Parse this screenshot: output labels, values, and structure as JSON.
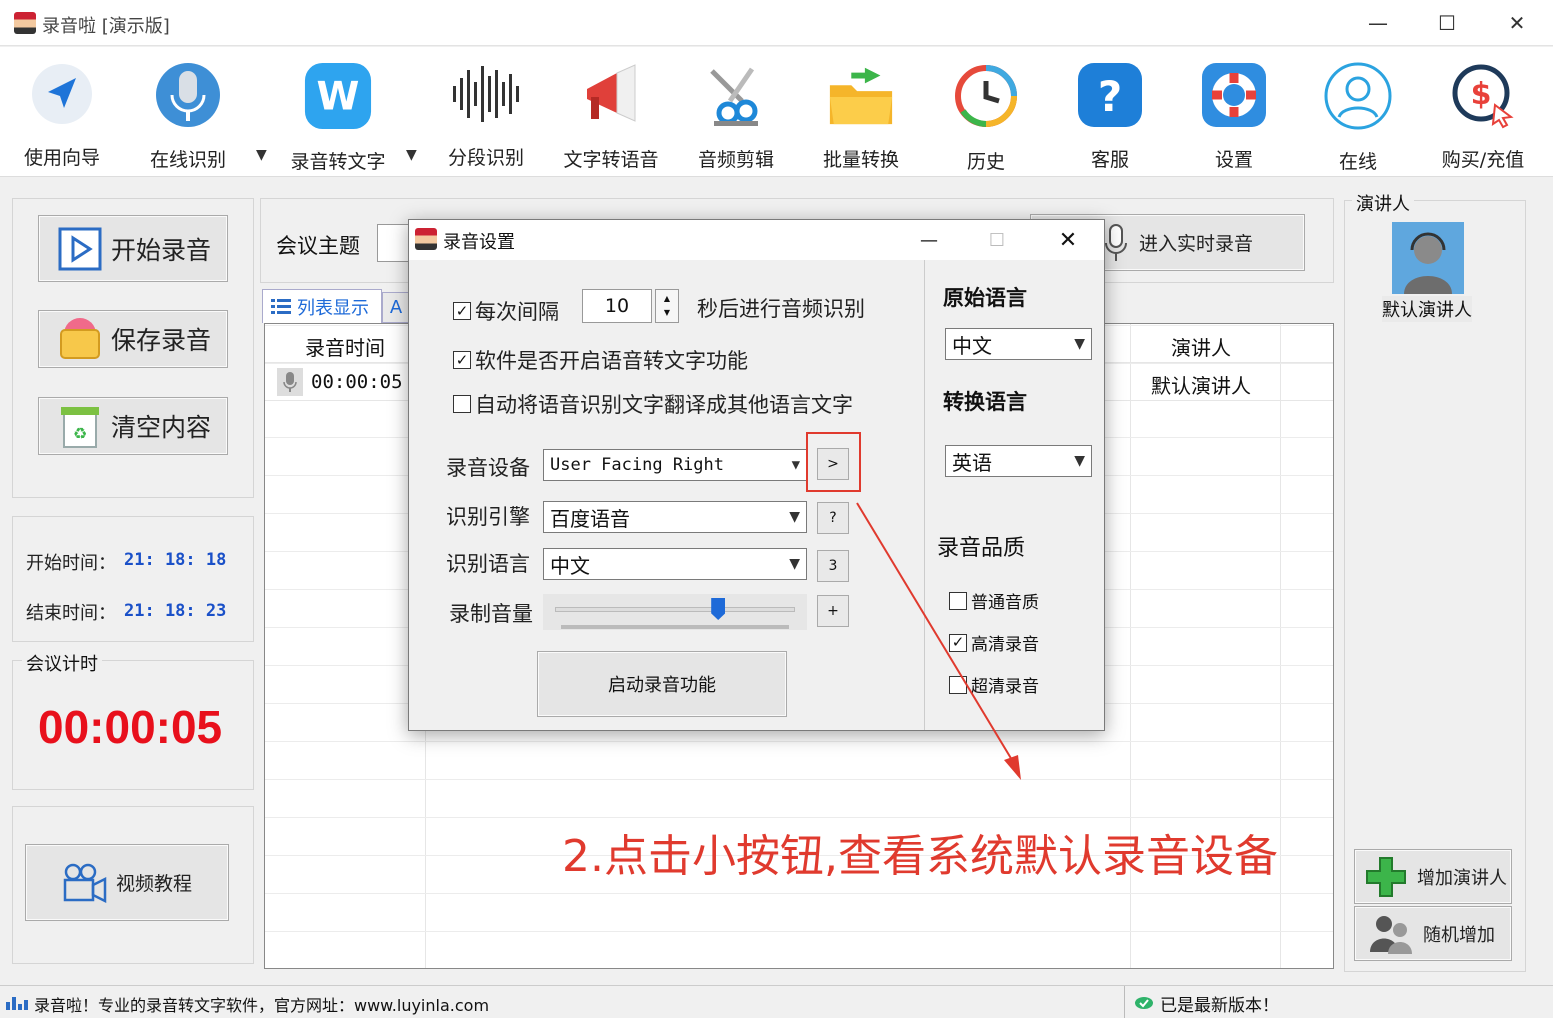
{
  "window": {
    "title": "录音啦 [演示版]",
    "minimize": "—",
    "maximize": "☐",
    "close": "✕"
  },
  "toolbar": [
    {
      "label": "使用向导",
      "icon": "navigation-arrow-icon"
    },
    {
      "label": "在线识别",
      "icon": "microphone-icon"
    },
    {
      "label": "录音转文字",
      "icon": "w-logo-icon"
    },
    {
      "label": "分段识别",
      "icon": "waveform-icon"
    },
    {
      "label": "文字转语音",
      "icon": "megaphone-icon"
    },
    {
      "label": "音频剪辑",
      "icon": "scissors-icon"
    },
    {
      "label": "批量转换",
      "icon": "folder-icon"
    },
    {
      "label": "历史",
      "icon": "history-clock-icon"
    },
    {
      "label": "客服",
      "icon": "question-icon"
    },
    {
      "label": "设置",
      "icon": "lifebuoy-icon"
    },
    {
      "label": "在线",
      "icon": "user-outline-icon"
    },
    {
      "label": "购买/充值",
      "icon": "dollar-coin-icon"
    }
  ],
  "left": {
    "start_btn": "开始录音",
    "save_btn": "保存录音",
    "clear_btn": "清空内容",
    "start_time_label": "开始时间：",
    "start_time_value": "21: 18: 18",
    "end_time_label": "结束时间：",
    "end_time_value": "21: 18: 23",
    "timer_group": "会议计时",
    "timer_value": "00:00:05",
    "video_btn": "视频教程"
  },
  "main": {
    "topic_label": "会议主题",
    "realtime_btn": "进入实时录音",
    "tab_list": "列表显示",
    "tab_other": "A",
    "col_time": "录音时间",
    "col_speaker": "演讲人",
    "row_time": "00:00:05",
    "row_speaker": "默认演讲人"
  },
  "right": {
    "group_title": "演讲人",
    "default_speaker": "默认演讲人",
    "add_btn": "增加演讲人",
    "random_btn": "随机增加"
  },
  "dialog": {
    "title": "录音设置",
    "interval_prefix": "每次间隔",
    "interval_value": "10",
    "interval_suffix": "秒后进行音频识别",
    "opt_stt": "软件是否开启语音转文字功能",
    "opt_translate": "自动将语音识别文字翻译成其他语言文字",
    "device_label": "录音设备",
    "device_value": "User Facing Right",
    "device_btn": ">",
    "engine_label": "识别引擎",
    "engine_value": "百度语音",
    "engine_btn": "?",
    "lang_label": "识别语言",
    "lang_value": "中文",
    "lang_btn": "3",
    "volume_label": "录制音量",
    "volume_btn": "+",
    "volume_level": 0.68,
    "start_btn": "启动录音功能",
    "src_lang_title": "原始语言",
    "src_lang_value": "中文",
    "dst_lang_title": "转换语言",
    "dst_lang_value": "英语",
    "quality_title": "录音品质",
    "q_normal": "普通音质",
    "q_hd": "高清录音",
    "q_uhd": "超清录音",
    "checkbox_mark": "✓"
  },
  "annotation": "2.点击小按钮,查看系统默认录音设备",
  "status": {
    "left_text": "录音啦！专业的录音转文字软件，官方网址：www.luyinla.com",
    "right_text": "已是最新版本！"
  },
  "colors": {
    "accent_blue": "#1a50c8",
    "timer_red": "#e8101c",
    "annotation_red": "#e03a2e"
  }
}
